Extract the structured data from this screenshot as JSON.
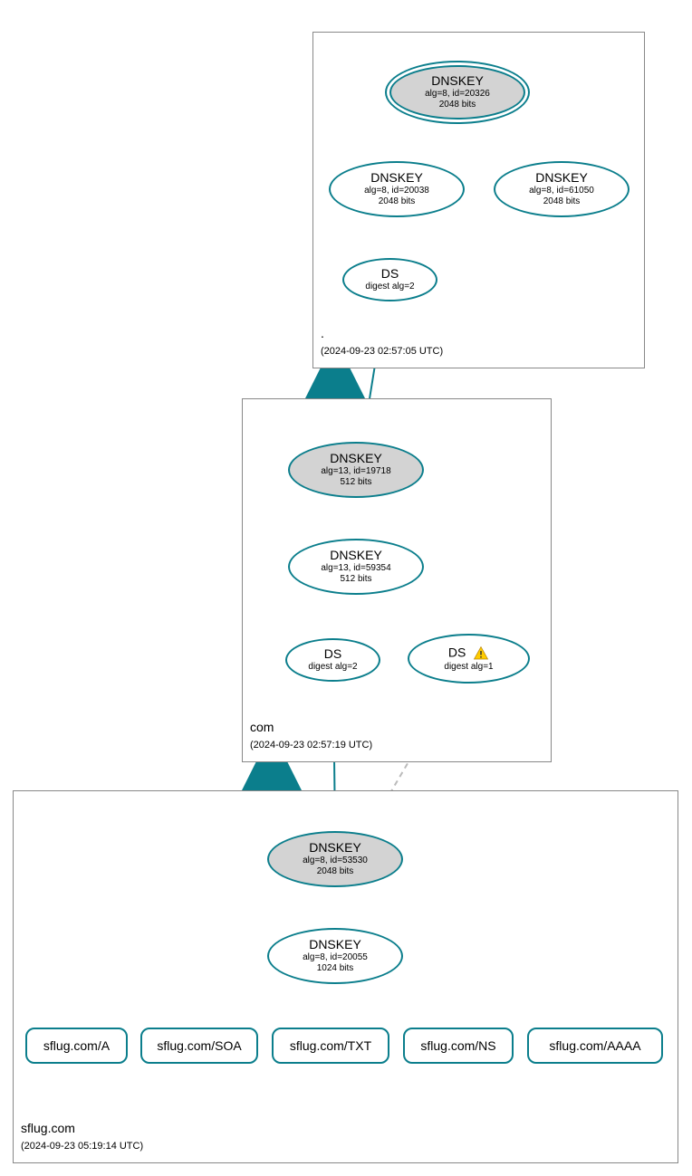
{
  "colors": {
    "stroke": "#0b7e8c",
    "fill_ksk": "#d3d3d3",
    "dashed": "#bbbbbb",
    "box": "#888888"
  },
  "zones": {
    "root": {
      "label": ".",
      "timestamp": "(2024-09-23 02:57:05 UTC)"
    },
    "com": {
      "label": "com",
      "timestamp": "(2024-09-23 02:57:19 UTC)"
    },
    "leaf": {
      "label": "sflug.com",
      "timestamp": "(2024-09-23 05:19:14 UTC)"
    }
  },
  "nodes": {
    "root_ksk": {
      "title": "DNSKEY",
      "line1": "alg=8, id=20326",
      "line2": "2048 bits"
    },
    "root_zsk1": {
      "title": "DNSKEY",
      "line1": "alg=8, id=20038",
      "line2": "2048 bits"
    },
    "root_zsk2": {
      "title": "DNSKEY",
      "line1": "alg=8, id=61050",
      "line2": "2048 bits"
    },
    "root_ds": {
      "title": "DS",
      "line1": "digest alg=2"
    },
    "com_ksk": {
      "title": "DNSKEY",
      "line1": "alg=13, id=19718",
      "line2": "512 bits"
    },
    "com_zsk": {
      "title": "DNSKEY",
      "line1": "alg=13, id=59354",
      "line2": "512 bits"
    },
    "com_ds1": {
      "title": "DS",
      "line1": "digest alg=2"
    },
    "com_ds2": {
      "title": "DS",
      "line1": "digest alg=1"
    },
    "leaf_ksk": {
      "title": "DNSKEY",
      "line1": "alg=8, id=53530",
      "line2": "2048 bits"
    },
    "leaf_zsk": {
      "title": "DNSKEY",
      "line1": "alg=8, id=20055",
      "line2": "1024 bits"
    }
  },
  "rr": {
    "a": "sflug.com/A",
    "soa": "sflug.com/SOA",
    "txt": "sflug.com/TXT",
    "ns": "sflug.com/NS",
    "aaaa": "sflug.com/AAAA"
  }
}
